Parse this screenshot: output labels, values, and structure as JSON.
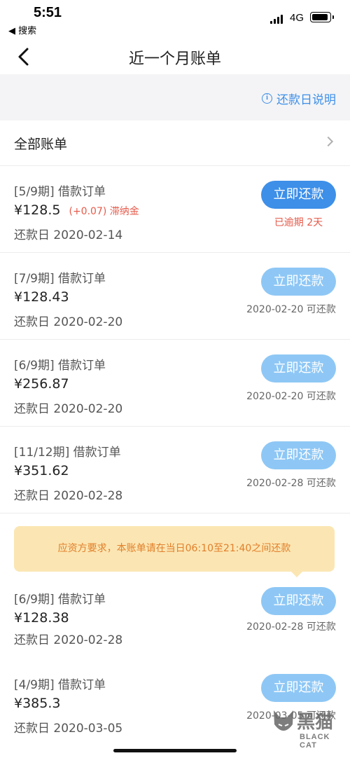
{
  "status_bar": {
    "time": "5:51",
    "back_app": "◀ 搜索",
    "network": "4G"
  },
  "nav": {
    "title": "近一个月账单"
  },
  "explain": {
    "link": "还款日说明"
  },
  "all_bills": {
    "label": "全部账单"
  },
  "bills": [
    {
      "period": "[5/9期] 借款订单",
      "amount": "¥128.5",
      "late_fee": "(+0.07) 滞纳金",
      "date": "还款日 2020-02-14",
      "button": "立即还款",
      "status": "已逾期 2天",
      "active": true
    },
    {
      "period": "[7/9期] 借款订单",
      "amount": "¥128.43",
      "date": "还款日 2020-02-20",
      "button": "立即还款",
      "status": "2020-02-20 可还款",
      "active": false
    },
    {
      "period": "[6/9期] 借款订单",
      "amount": "¥256.87",
      "date": "还款日 2020-02-20",
      "button": "立即还款",
      "status": "2020-02-20 可还款",
      "active": false
    },
    {
      "period": "[11/12期] 借款订单",
      "amount": "¥351.62",
      "date": "还款日 2020-02-28",
      "button": "立即还款",
      "status": "2020-02-28 可还款",
      "active": false
    },
    {
      "period": "[6/9期] 借款订单",
      "amount": "¥128.38",
      "date": "还款日 2020-02-28",
      "button": "立即还款",
      "status": "2020-02-28 可还款",
      "active": false
    },
    {
      "period": "[4/9期] 借款订单",
      "amount": "¥385.3",
      "date": "还款日 2020-03-05",
      "button": "立即还款",
      "status": "2020-03-05 可还款",
      "active": false
    }
  ],
  "notice": {
    "text": "应资方要求，本账单请在当日06:10至21:40之间还款"
  },
  "watermark": {
    "text": "黑猫",
    "sub": "BLACK CAT"
  },
  "colors": {
    "accent": "#3d8fe8",
    "accent_disabled": "#8ec7f5",
    "warning": "#e65a4a",
    "notice_bg": "#fbe6b3",
    "notice_text": "#e27f2a"
  },
  "icons": {
    "back": "chevron-left-icon",
    "info": "info-circle-icon",
    "chevron": "chevron-right-icon"
  }
}
